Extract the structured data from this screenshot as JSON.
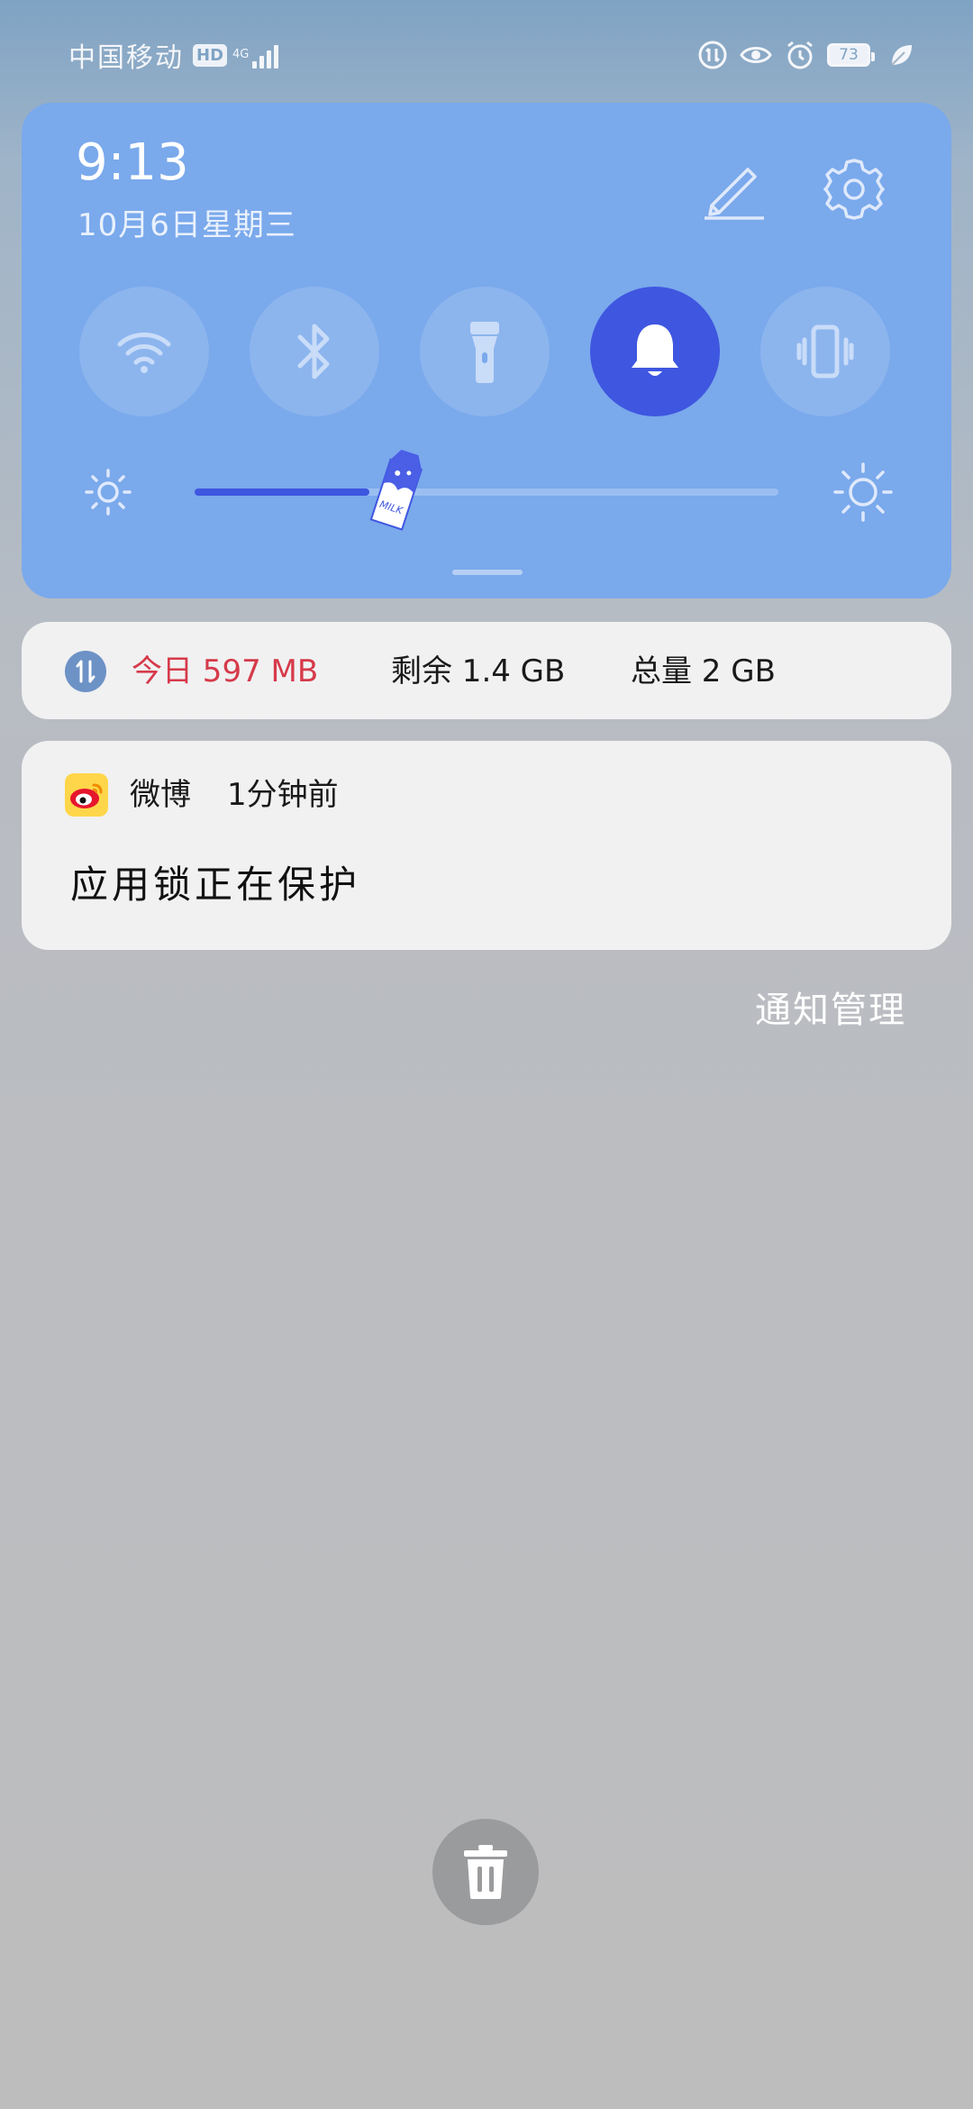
{
  "status_bar": {
    "carrier": "中国移动",
    "hd_badge": "HD",
    "network_type": "4G",
    "battery_level": "73",
    "icons": [
      "data-usage-icon",
      "eye-icon",
      "alarm-icon",
      "battery-icon",
      "leaf-icon"
    ]
  },
  "control_panel": {
    "time": "9:13",
    "date": "10月6日星期三",
    "toggles": [
      {
        "name": "wifi",
        "icon": "wifi-icon",
        "active": false
      },
      {
        "name": "bluetooth",
        "icon": "bluetooth-icon",
        "active": false
      },
      {
        "name": "flashlight",
        "icon": "flashlight-icon",
        "active": false
      },
      {
        "name": "sound",
        "icon": "bell-icon",
        "active": true
      },
      {
        "name": "vibrate",
        "icon": "vibrate-icon",
        "active": false
      }
    ],
    "brightness_level": 0.3,
    "slider_thumb_label": "MILK",
    "colors": {
      "panel": "#7aa9ec",
      "accent": "#3f56e0"
    }
  },
  "data_usage": {
    "today": "今日 597 MB",
    "remaining": "剩余 1.4 GB",
    "total": "总量 2 GB",
    "today_color": "#d63a4a"
  },
  "notification": {
    "app_name": "微博",
    "time": "1分钟前",
    "body": "应用锁正在保护"
  },
  "notification_manage": "通知管理",
  "clear_button_icon": "trash-icon"
}
